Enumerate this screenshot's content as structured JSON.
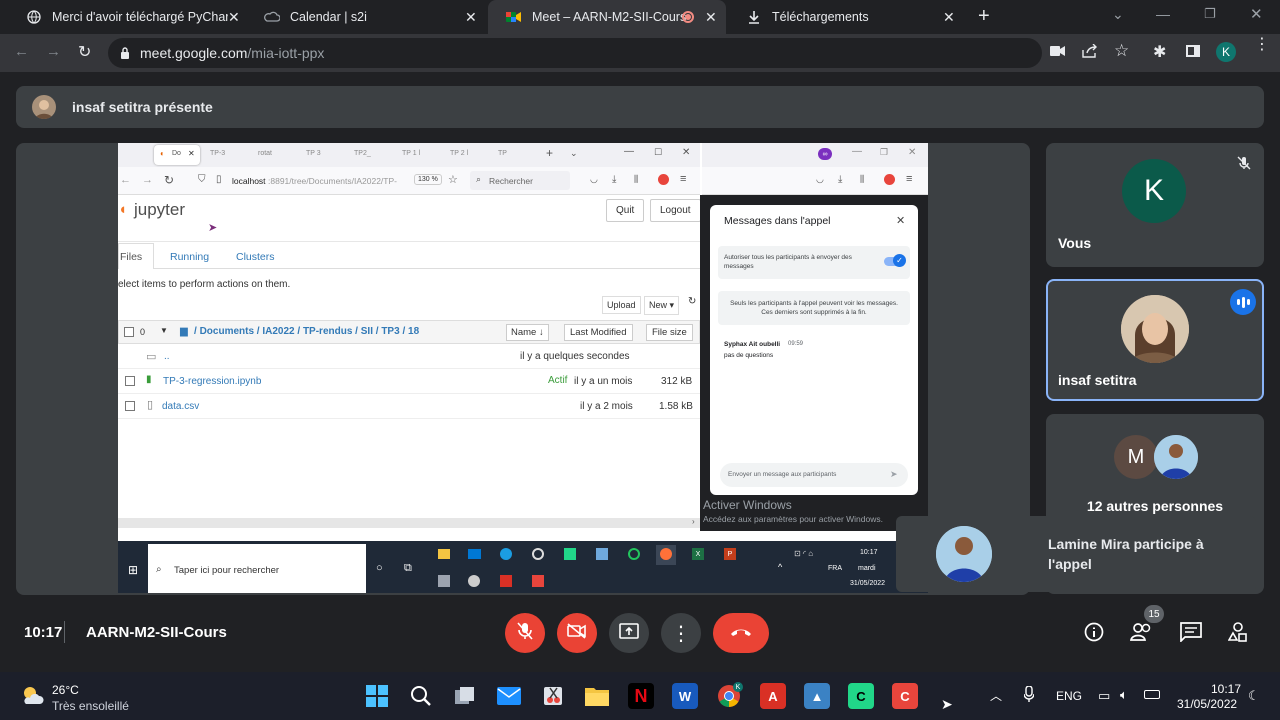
{
  "chrome": {
    "tabs": [
      {
        "title": "Merci d'avoir téléchargé PyCharm"
      },
      {
        "title": "Calendar | s2i"
      },
      {
        "title": "Meet – AARN-M2-SII-Cours"
      },
      {
        "title": "Téléchargements"
      }
    ],
    "url_host": "meet.google.com",
    "url_path": "/mia-iott-ppx",
    "profile_initial": "K"
  },
  "meet": {
    "presenting_banner": "insaf setitra présente",
    "time": "10:17",
    "meeting_name": "AARN-M2-SII-Cours",
    "participants_count": "15",
    "tiles": [
      {
        "name": "Vous",
        "initial": "K"
      },
      {
        "name": "insaf setitra"
      },
      {
        "name": "12 autres personnes",
        "initial": "M"
      }
    ],
    "notification": "Lamine Mira participe à l'appel"
  },
  "shared_screen": {
    "inner_tabs": [
      "Do",
      "TP-3",
      "rotat",
      "TP 3",
      "TP2_",
      "TP 1 l",
      "TP 2 l",
      "TP"
    ],
    "inner_url_host": "localhost",
    "inner_url_rest": ":8891/tree/Documents/IA2022/TP-",
    "zoom": "130 %",
    "search_placeholder": "Rechercher",
    "jupyter": {
      "logo": "jupyter",
      "quit": "Quit",
      "logout": "Logout",
      "tabs": [
        "Files",
        "Running",
        "Clusters"
      ],
      "hint": "elect items to perform actions on them.",
      "upload": "Upload",
      "new": "New",
      "select_count": "0",
      "breadcrumb": [
        "Documents",
        "IA2022",
        "TP-rendus",
        "SII",
        "TP3",
        "18"
      ],
      "col_name": "Name",
      "col_modified": "Last Modified",
      "col_size": "File size",
      "rows": [
        {
          "name": "..",
          "status": "",
          "modified": "il y a quelques secondes",
          "size": ""
        },
        {
          "name": "TP-3-regression.ipynb",
          "status": "Actif",
          "modified": "il y a un mois",
          "size": "312 kB"
        },
        {
          "name": "data.csv",
          "status": "",
          "modified": "il y a 2 mois",
          "size": "1.58 kB"
        }
      ]
    },
    "chat": {
      "title": "Messages dans l'appel",
      "toggle_label": "Autoriser tous les participants à envoyer des messages",
      "info": "Seuls les participants à l'appel peuvent voir les messages. Ces derniers sont supprimés à la fin.",
      "sender": "Syphax Ait oubelli",
      "sent_time": "09:59",
      "message": "pas de questions",
      "input_placeholder": "Envoyer un message aux participants"
    },
    "activate_windows": "Activer Windows",
    "activate_sub": "Accédez aux paramètres pour activer Windows.",
    "inner_taskbar": {
      "search": "Taper ici pour rechercher",
      "time": "10:17",
      "day": "mardi",
      "date": "31/05/2022",
      "lang": "FRA"
    }
  },
  "taskbar": {
    "weather_temp": "26°C",
    "weather_desc": "Très ensoleillé",
    "lang": "ENG",
    "time": "10:17",
    "date": "31/05/2022"
  }
}
